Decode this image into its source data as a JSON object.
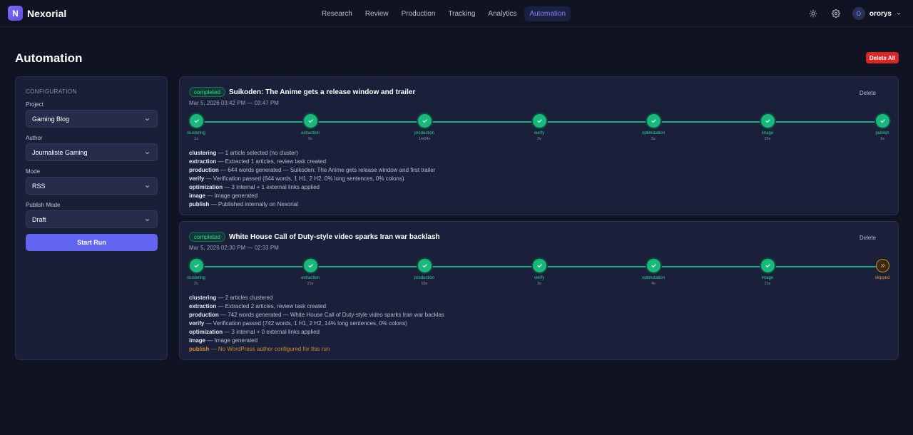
{
  "app": {
    "logo_letter": "N",
    "name": "Nexorial"
  },
  "nav": {
    "items": [
      {
        "label": "Research"
      },
      {
        "label": "Review"
      },
      {
        "label": "Production"
      },
      {
        "label": "Tracking"
      },
      {
        "label": "Analytics"
      },
      {
        "label": "Automation",
        "active": true
      }
    ]
  },
  "user": {
    "initial": "O",
    "name": "ororys"
  },
  "page": {
    "title": "Automation",
    "delete_all_label": "Delete All"
  },
  "config": {
    "title": "CONFIGURATION",
    "project_label": "Project",
    "project_value": "Gaming Blog",
    "author_label": "Author",
    "author_value": "Journaliste Gaming",
    "mode_label": "Mode",
    "mode_value": "RSS",
    "publish_mode_label": "Publish Mode",
    "publish_mode_value": "Draft",
    "start_label": "Start Run"
  },
  "runs": [
    {
      "status": "completed",
      "title": "Suikoden: The Anime gets a release window and trailer",
      "time": "Mar 5, 2026 03:42 PM — 03:47 PM",
      "delete_label": "Delete",
      "steps": [
        {
          "name": "clustering",
          "duration": "1s",
          "state": "done"
        },
        {
          "name": "extraction",
          "duration": "9s",
          "state": "done"
        },
        {
          "name": "production",
          "duration": "1m04s",
          "state": "done"
        },
        {
          "name": "verify",
          "duration": "2s",
          "state": "done"
        },
        {
          "name": "optimization",
          "duration": "5s",
          "state": "done"
        },
        {
          "name": "image",
          "duration": "22s",
          "state": "done"
        },
        {
          "name": "publish",
          "duration": "1s",
          "state": "done"
        }
      ],
      "log": [
        {
          "key": "clustering",
          "text": " — 1 article selected (no cluster)"
        },
        {
          "key": "extraction",
          "text": " — Extracted 1 articles, review task created"
        },
        {
          "key": "production",
          "text": " — 644 words generated — Suikoden: The Anime gets release window and first trailer"
        },
        {
          "key": "verify",
          "text": " — Verification passed (644 words, 1 H1, 2 H2, 0% long sentences, 0% colons)"
        },
        {
          "key": "optimization",
          "text": " — 3 internal + 1 external links applied"
        },
        {
          "key": "image",
          "text": " — Image generated"
        },
        {
          "key": "publish",
          "text": " — Published internally on Nexorial"
        }
      ]
    },
    {
      "status": "completed",
      "title": "White House Call of Duty-style video sparks Iran war backlash",
      "time": "Mar 5, 2026 02:30 PM — 02:33 PM",
      "delete_label": "Delete",
      "steps": [
        {
          "name": "clustering",
          "duration": "2s",
          "state": "done"
        },
        {
          "name": "extraction",
          "duration": "21s",
          "state": "done"
        },
        {
          "name": "production",
          "duration": "59s",
          "state": "done"
        },
        {
          "name": "verify",
          "duration": "3s",
          "state": "done"
        },
        {
          "name": "optimization",
          "duration": "4s",
          "state": "done"
        },
        {
          "name": "image",
          "duration": "21s",
          "state": "done"
        },
        {
          "name": "skipped",
          "duration": "",
          "state": "skipped"
        }
      ],
      "log": [
        {
          "key": "clustering",
          "text": " — 2 articles clustered"
        },
        {
          "key": "extraction",
          "text": " — Extracted 2 articles, review task created"
        },
        {
          "key": "production",
          "text": " — 742 words generated — White House Call of Duty-style video sparks Iran war backlas"
        },
        {
          "key": "verify",
          "text": " — Verification passed (742 words, 1 H1, 2 H2, 14% long sentences, 0% colons)"
        },
        {
          "key": "optimization",
          "text": " — 3 internal + 0 external links applied"
        },
        {
          "key": "image",
          "text": " — Image generated"
        },
        {
          "key": "publish",
          "text": " — No WordPress author configured for this run",
          "warn": true
        }
      ]
    }
  ],
  "colors": {
    "accent": "#6366f1",
    "success": "#34d399",
    "danger": "#dc2626",
    "warning": "#d4892a"
  }
}
